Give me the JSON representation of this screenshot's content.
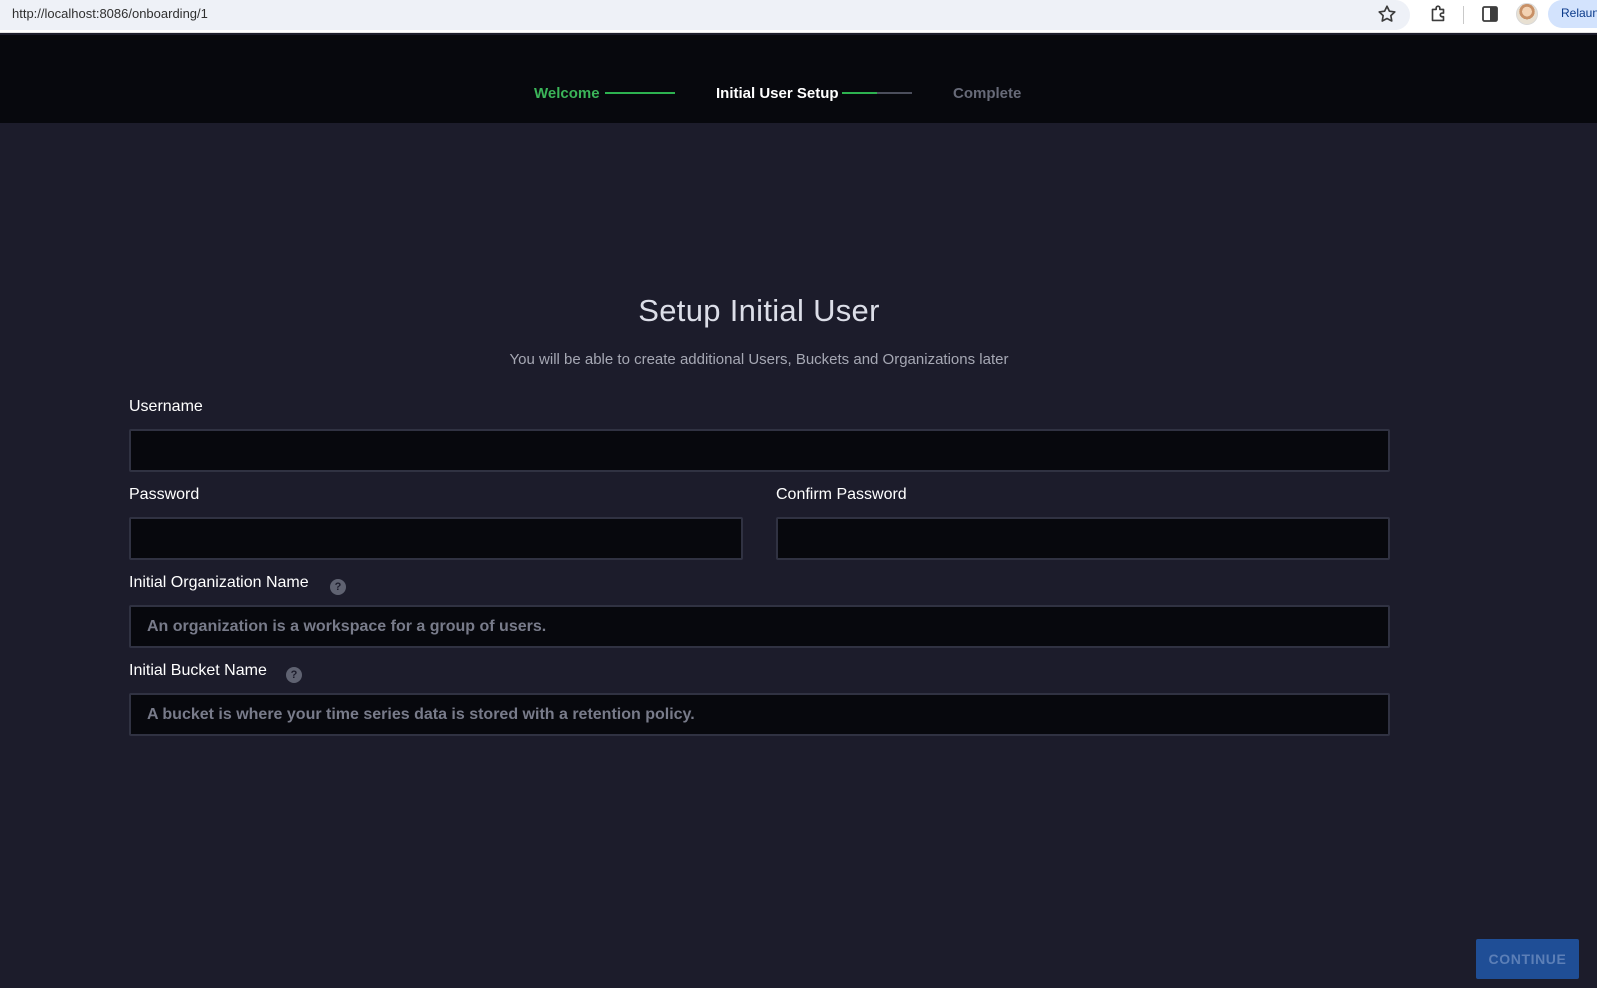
{
  "browser": {
    "url": "http://localhost:8086/onboarding/1",
    "relaunch_label": "Relaun"
  },
  "stepper": {
    "steps": [
      {
        "label": "Welcome",
        "status": "done"
      },
      {
        "label": "Initial User Setup",
        "status": "current"
      },
      {
        "label": "Complete",
        "status": "pending"
      }
    ],
    "colors": {
      "done": "#3bb559",
      "current": "#ffffff",
      "pending": "#676a78"
    }
  },
  "form": {
    "title": "Setup Initial User",
    "subtitle": "You will be able to create additional Users, Buckets and Organizations later",
    "username": {
      "label": "Username",
      "value": "",
      "placeholder": ""
    },
    "password": {
      "label": "Password",
      "value": "",
      "placeholder": ""
    },
    "confirm_password": {
      "label": "Confirm Password",
      "value": "",
      "placeholder": ""
    },
    "org_name": {
      "label": "Initial Organization Name",
      "value": "",
      "placeholder": "An organization is a workspace for a group of users."
    },
    "bucket_name": {
      "label": "Initial Bucket Name",
      "value": "",
      "placeholder": "A bucket is where your time series data is stored with a retention policy."
    },
    "help_glyph": "?",
    "continue_label": "CONTINUE"
  },
  "icons": [
    "star-icon",
    "extensions-icon",
    "side-panel-icon",
    "help-icon"
  ]
}
